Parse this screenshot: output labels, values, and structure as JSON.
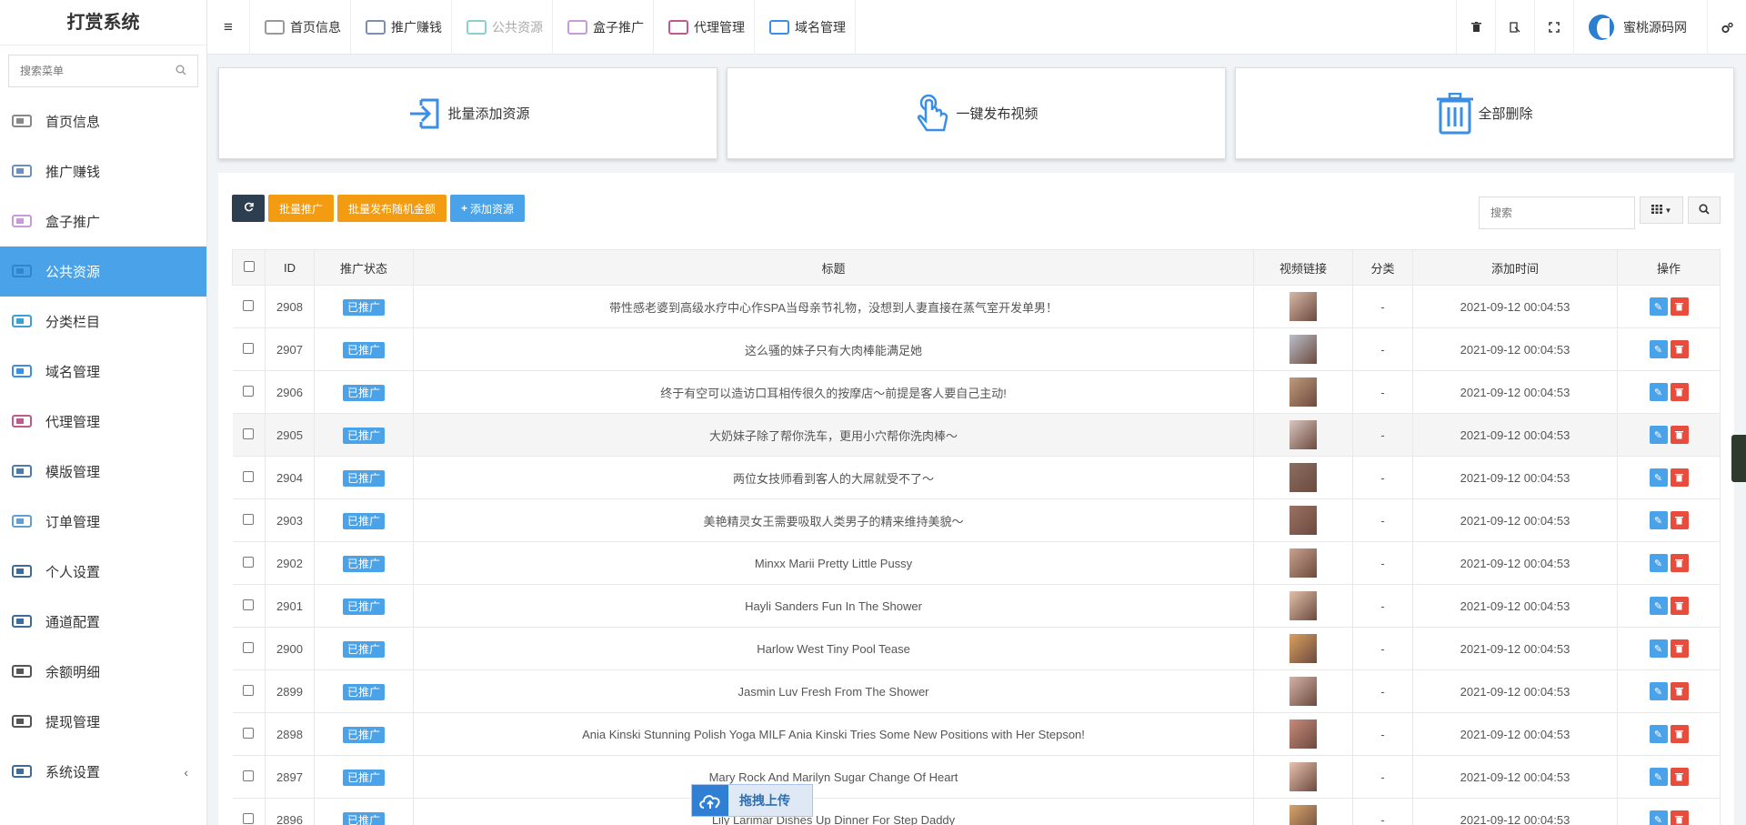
{
  "brand": "打赏系统",
  "sidebar": {
    "search_placeholder": "搜索菜单",
    "items": [
      {
        "label": "首页信息",
        "icon": "home-icon"
      },
      {
        "label": "推广赚钱",
        "icon": "promote-icon"
      },
      {
        "label": "盒子推广",
        "icon": "box-icon"
      },
      {
        "label": "公共资源",
        "icon": "resource-icon",
        "active": true
      },
      {
        "label": "分类栏目",
        "icon": "category-icon"
      },
      {
        "label": "域名管理",
        "icon": "domain-icon"
      },
      {
        "label": "代理管理",
        "icon": "agent-icon"
      },
      {
        "label": "模版管理",
        "icon": "template-icon"
      },
      {
        "label": "订单管理",
        "icon": "order-icon"
      },
      {
        "label": "个人设置",
        "icon": "profile-icon"
      },
      {
        "label": "通道配置",
        "icon": "channel-icon"
      },
      {
        "label": "余额明细",
        "icon": "balance-icon"
      },
      {
        "label": "提现管理",
        "icon": "withdraw-icon"
      },
      {
        "label": "系统设置",
        "icon": "settings-icon"
      }
    ]
  },
  "topnav": {
    "items": [
      {
        "label": "首页信息"
      },
      {
        "label": "推广赚钱"
      },
      {
        "label": "公共资源"
      },
      {
        "label": "盒子推广"
      },
      {
        "label": "代理管理"
      },
      {
        "label": "域名管理"
      }
    ],
    "user_name": "蜜桃源码网"
  },
  "cards": [
    {
      "label": "批量添加资源",
      "icon": "import-icon"
    },
    {
      "label": "一键发布视频",
      "icon": "tap-icon"
    },
    {
      "label": "全部删除",
      "icon": "trash-icon"
    }
  ],
  "toolbar": {
    "batch_promote": "批量推广",
    "batch_random": "批量发布随机金额",
    "add_resource": "添加资源",
    "search_placeholder": "搜索"
  },
  "table": {
    "headers": [
      "ID",
      "推广状态",
      "标题",
      "视频链接",
      "分类",
      "添加时间",
      "操作"
    ],
    "rows": [
      {
        "id": "2908",
        "status": "已推广",
        "title": "带性感老婆到高级水疗中心作SPA当母亲节礼物，没想到人妻直接在蒸气室开发单男！",
        "category": "-",
        "time": "2021-09-12 00:04:53"
      },
      {
        "id": "2907",
        "status": "已推广",
        "title": "这么骚的妹子只有大肉棒能满足她",
        "category": "-",
        "time": "2021-09-12 00:04:53"
      },
      {
        "id": "2906",
        "status": "已推广",
        "title": "终于有空可以造访口耳相传很久的按摩店～前提是客人要自己主动!",
        "category": "-",
        "time": "2021-09-12 00:04:53"
      },
      {
        "id": "2905",
        "status": "已推广",
        "title": "大奶妹子除了帮你洗车，更用小穴帮你洗肉棒～",
        "category": "-",
        "time": "2021-09-12 00:04:53"
      },
      {
        "id": "2904",
        "status": "已推广",
        "title": "两位女技师看到客人的大屌就受不了～",
        "category": "-",
        "time": "2021-09-12 00:04:53"
      },
      {
        "id": "2903",
        "status": "已推广",
        "title": "美艳精灵女王需要吸取人类男子的精来维持美貌～",
        "category": "-",
        "time": "2021-09-12 00:04:53"
      },
      {
        "id": "2902",
        "status": "已推广",
        "title": "Minxx Marii Pretty Little Pussy",
        "category": "-",
        "time": "2021-09-12 00:04:53"
      },
      {
        "id": "2901",
        "status": "已推广",
        "title": "Hayli Sanders Fun In The Shower",
        "category": "-",
        "time": "2021-09-12 00:04:53"
      },
      {
        "id": "2900",
        "status": "已推广",
        "title": "Harlow West Tiny Pool Tease",
        "category": "-",
        "time": "2021-09-12 00:04:53"
      },
      {
        "id": "2899",
        "status": "已推广",
        "title": "Jasmin Luv Fresh From The Shower",
        "category": "-",
        "time": "2021-09-12 00:04:53"
      },
      {
        "id": "2898",
        "status": "已推广",
        "title": "Ania Kinski Stunning Polish Yoga MILF Ania Kinski Tries Some New Positions with Her Stepson!",
        "category": "-",
        "time": "2021-09-12 00:04:53"
      },
      {
        "id": "2897",
        "status": "已推广",
        "title": "Mary Rock And Marilyn Sugar Change Of Heart",
        "category": "-",
        "time": "2021-09-12 00:04:53"
      },
      {
        "id": "2896",
        "status": "已推广",
        "title": "Lily Larimar Dishes Up Dinner For Step Daddy",
        "category": "-",
        "time": "2021-09-12 00:04:53"
      }
    ]
  },
  "upload_widget": {
    "label": "拖拽上传"
  },
  "colors": {
    "accent": "#4aa3e8",
    "orange": "#f39c12",
    "dark": "#2c3e50",
    "danger": "#e74c3c"
  }
}
